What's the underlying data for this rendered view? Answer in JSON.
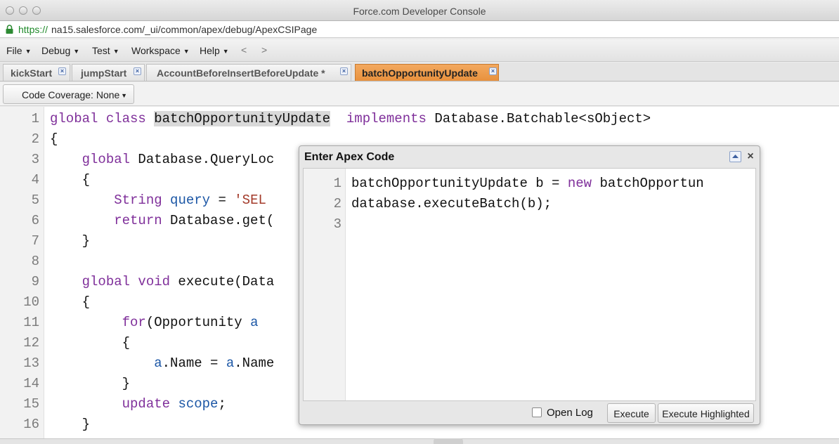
{
  "window": {
    "title": "Force.com Developer Console"
  },
  "address": {
    "scheme": "https://",
    "rest": "na15.salesforce.com/_ui/common/apex/debug/ApexCSIPage"
  },
  "menu": {
    "items": [
      "File",
      "Debug",
      "Test",
      "Workspace",
      "Help"
    ],
    "back": "<",
    "forward": ">"
  },
  "tabs": [
    {
      "label": "kickStart"
    },
    {
      "label": "jumpStart"
    },
    {
      "label": "AccountBeforeInsertBeforeUpdate *"
    },
    {
      "label": "batchOpportunityUpdate"
    }
  ],
  "toolbar": {
    "coverage": "Code Coverage: None"
  },
  "editor": {
    "lines": [
      {
        "n": "1",
        "tokens": [
          [
            "kw",
            "global class "
          ],
          [
            "hl",
            "batchOpportunityUpdate"
          ],
          [
            "",
            "  "
          ],
          [
            "kw",
            "implements"
          ],
          [
            "",
            " Database.Batchable<sObject>"
          ]
        ]
      },
      {
        "n": "2",
        "tokens": [
          [
            "",
            "{"
          ]
        ]
      },
      {
        "n": "3",
        "tokens": [
          [
            "",
            "    "
          ],
          [
            "kw",
            "global"
          ],
          [
            "",
            " Database.QueryLoc"
          ]
        ]
      },
      {
        "n": "4",
        "tokens": [
          [
            "",
            "    {"
          ]
        ]
      },
      {
        "n": "5",
        "tokens": [
          [
            "",
            "        "
          ],
          [
            "kw",
            "String"
          ],
          [
            "",
            " "
          ],
          [
            "ty",
            "query"
          ],
          [
            "",
            " = "
          ],
          [
            "st",
            "'SEL"
          ]
        ]
      },
      {
        "n": "6",
        "tokens": [
          [
            "",
            "        "
          ],
          [
            "kw",
            "return"
          ],
          [
            "",
            " Database.get("
          ]
        ]
      },
      {
        "n": "7",
        "tokens": [
          [
            "",
            "    }"
          ]
        ]
      },
      {
        "n": "8",
        "tokens": []
      },
      {
        "n": "9",
        "tokens": [
          [
            "",
            "    "
          ],
          [
            "kw",
            "global void"
          ],
          [
            "",
            " execute(Data"
          ]
        ]
      },
      {
        "n": "10",
        "tokens": [
          [
            "",
            "    {"
          ]
        ]
      },
      {
        "n": "11",
        "tokens": [
          [
            "",
            "         "
          ],
          [
            "kw",
            "for"
          ],
          [
            "",
            "(Opportunity "
          ],
          [
            "ty",
            "a"
          ]
        ]
      },
      {
        "n": "12",
        "tokens": [
          [
            "",
            "         {"
          ]
        ]
      },
      {
        "n": "13",
        "tokens": [
          [
            "",
            "             "
          ],
          [
            "ty",
            "a"
          ],
          [
            "",
            ".Name = "
          ],
          [
            "ty",
            "a"
          ],
          [
            "",
            ".Name"
          ]
        ]
      },
      {
        "n": "14",
        "tokens": [
          [
            "",
            "         }"
          ]
        ]
      },
      {
        "n": "15",
        "tokens": [
          [
            "",
            "         "
          ],
          [
            "kw",
            "update"
          ],
          [
            "",
            " "
          ],
          [
            "ty",
            "scope"
          ],
          [
            "",
            ";"
          ]
        ]
      },
      {
        "n": "16",
        "tokens": [
          [
            "",
            "    }"
          ]
        ]
      }
    ]
  },
  "dialog": {
    "title": "Enter Apex Code",
    "lines": [
      {
        "n": "1",
        "tokens": [
          [
            "",
            "batchOpportunityUpdate b = "
          ],
          [
            "kw",
            "new"
          ],
          [
            "",
            " batchOpportun"
          ]
        ]
      },
      {
        "n": "2",
        "tokens": [
          [
            "",
            "database.executeBatch(b);"
          ]
        ]
      },
      {
        "n": "3",
        "tokens": []
      }
    ],
    "open_log": "Open Log",
    "execute": "Execute",
    "execute_highlighted": "Execute Highlighted"
  }
}
